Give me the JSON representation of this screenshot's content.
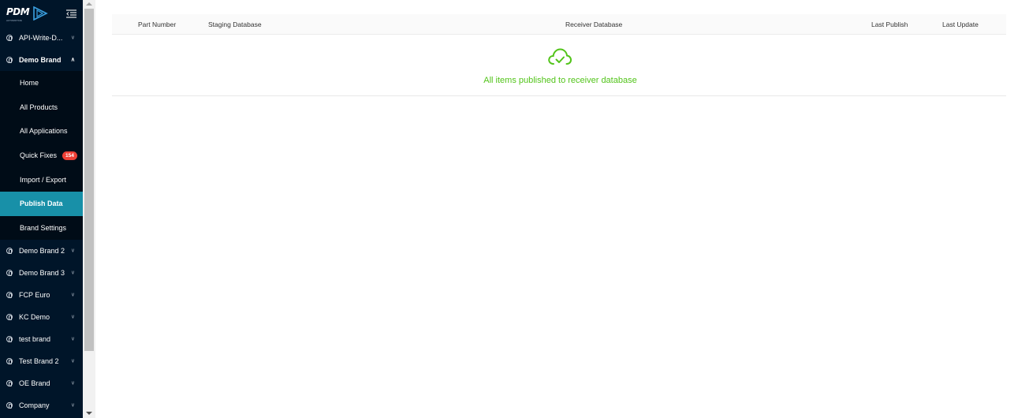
{
  "brand": {
    "logo_text": "PDM",
    "logo_subtext": "AUTOMOTIVE"
  },
  "sidebar": {
    "top_items": [
      {
        "label": "API-Write-D...",
        "expanded": false
      },
      {
        "label": "Demo Brand",
        "expanded": true
      }
    ],
    "sub_items": [
      {
        "label": "Home"
      },
      {
        "label": "All Products"
      },
      {
        "label": "All Applications"
      },
      {
        "label": "Quick Fixes",
        "badge": "154"
      },
      {
        "label": "Import / Export"
      },
      {
        "label": "Publish Data",
        "active": true
      },
      {
        "label": "Brand Settings"
      }
    ],
    "bottom_items": [
      {
        "label": "Demo Brand 2"
      },
      {
        "label": "Demo Brand 3"
      },
      {
        "label": "FCP Euro"
      },
      {
        "label": "KC Demo"
      },
      {
        "label": "test brand"
      },
      {
        "label": "Test Brand 2"
      },
      {
        "label": "OE Brand"
      },
      {
        "label": "Company"
      }
    ]
  },
  "table": {
    "columns": [
      "Part Number",
      "Staging Database",
      "Receiver Database",
      "Last Publish",
      "Last Update"
    ],
    "empty_message": "All items published to receiver database"
  },
  "colors": {
    "sidebar_bg": "#001529",
    "submenu_bg": "#000c17",
    "active_item": "#1890a8",
    "success_green": "#52c41a",
    "badge_red": "#ef4036"
  },
  "icons": [
    "menu-fold-icon",
    "brand-icon",
    "chevron-down-icon",
    "chevron-up-icon",
    "cloud-check-icon"
  ]
}
